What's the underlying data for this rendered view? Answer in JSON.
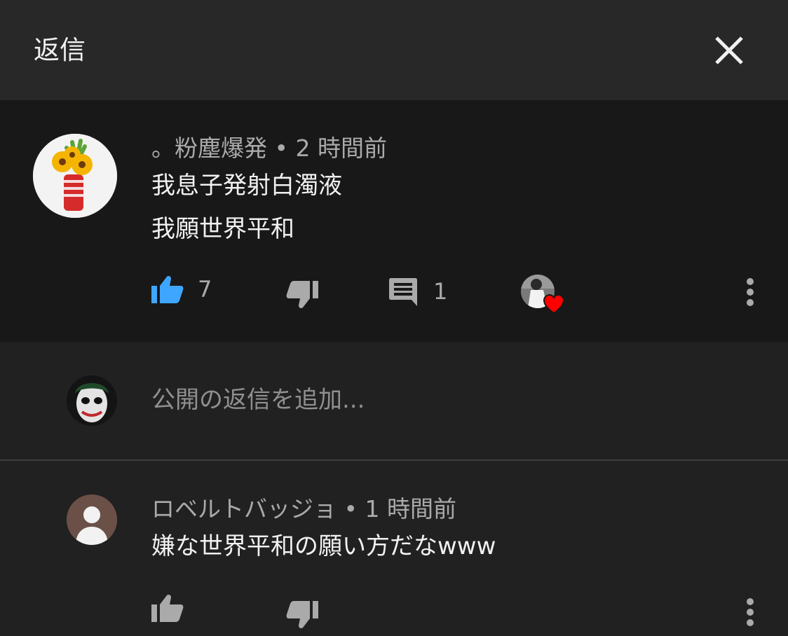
{
  "header": {
    "title": "返信"
  },
  "top_comment": {
    "author": "。粉塵爆発",
    "separator": "•",
    "time": "2 時間前",
    "lines": [
      "我息子発射白濁液",
      "我願世界平和"
    ],
    "like_count": "7",
    "reply_count": "1",
    "creator_heart": true,
    "colors": {
      "like_active": "#3ea6ff",
      "heart": "#ff0000"
    }
  },
  "reply_box": {
    "placeholder": "公開の返信を追加..."
  },
  "reply": {
    "author": "ロベルトバッジョ",
    "separator": "•",
    "time": "1 時間前",
    "text": "嫌な世界平和の願い方だなwww"
  }
}
